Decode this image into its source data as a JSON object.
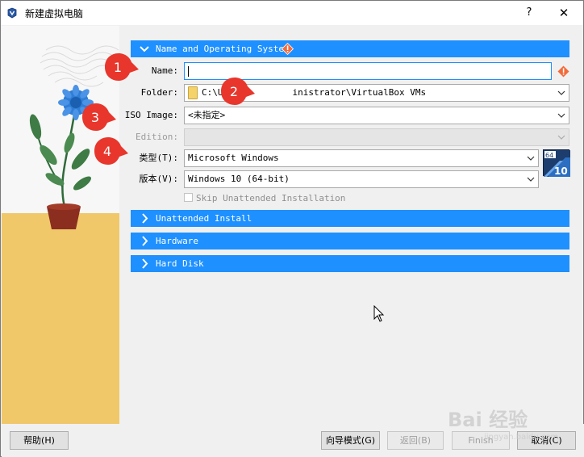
{
  "window": {
    "title": "新建虚拟电脑",
    "help_button": "?",
    "close_button": "✕"
  },
  "sections": {
    "name_os": {
      "label": "Name and Operating System",
      "expanded": true
    },
    "unattended": {
      "label": "Unattended Install",
      "expanded": false
    },
    "hardware": {
      "label": "Hardware",
      "expanded": false
    },
    "hard_disk": {
      "label": "Hard Disk",
      "expanded": false
    }
  },
  "form": {
    "name": {
      "label": "Name:",
      "value": ""
    },
    "folder": {
      "label": "Folder:",
      "value": "C:\\Users\\Administrator\\VirtualBox VMs",
      "visible_prefix": "C:\\U",
      "visible_suffix": "inistrator\\VirtualBox VMs"
    },
    "iso": {
      "label": "ISO Image:",
      "value": "<未指定>"
    },
    "edition": {
      "label": "Edition:",
      "value": ""
    },
    "type": {
      "label": "类型(T):",
      "value": "Microsoft Windows"
    },
    "version": {
      "label": "版本(V):",
      "value": "Windows 10 (64-bit)"
    },
    "skip_unattended": {
      "label": "Skip Unattended Installation",
      "checked": false,
      "enabled": false
    }
  },
  "os_badge": {
    "bits": "64",
    "version": "10"
  },
  "footer": {
    "help": "帮助(H)",
    "guided_mode": "向导模式(G)",
    "back": "返回(B)",
    "finish": "Finish",
    "cancel": "取消(C)"
  },
  "callouts": [
    "1",
    "2",
    "3",
    "4"
  ],
  "watermark": {
    "brand": "Bai  经验",
    "url": "jingyan.baidu.com"
  },
  "colors": {
    "accent": "#1e90ff",
    "warning": "#f26b3a",
    "callout": "#e8362c"
  }
}
